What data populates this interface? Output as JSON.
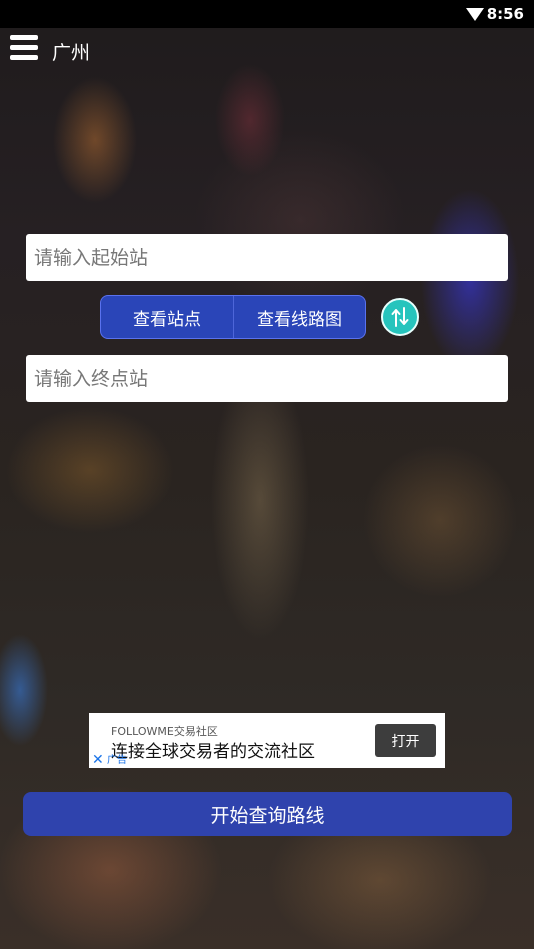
{
  "status_bar": {
    "time": "8:56",
    "wifi_icon": "wifi-icon"
  },
  "header": {
    "menu_icon": "menu-icon",
    "city": "广州"
  },
  "form": {
    "start_placeholder": "请输入起始站",
    "end_placeholder": "请输入终点站",
    "view_stations_label": "查看站点",
    "view_map_label": "查看线路图",
    "swap_icon": "swap-icon",
    "submit_label": "开始查询路线"
  },
  "ad": {
    "source": "FOLLOWME交易社区",
    "text": "连接全球交易者的交流社区",
    "open_label": "打开",
    "close_symbol": "✕",
    "tag": "广告"
  },
  "colors": {
    "button_blue": "#2f43ad",
    "segment_blue": "#2a45b8",
    "swap_teal": "#26c4bd"
  }
}
